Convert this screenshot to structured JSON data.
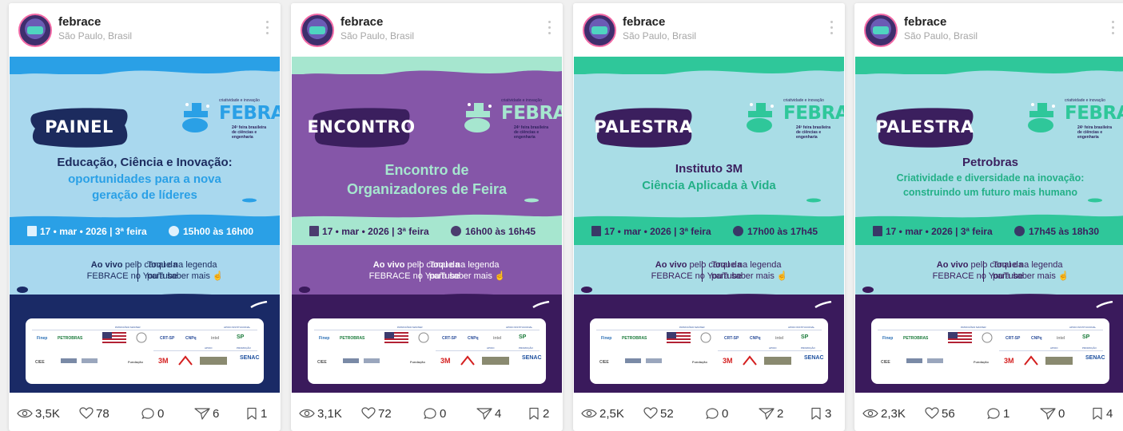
{
  "posts": [
    {
      "user": "febrace",
      "location": "São Paulo, Brasil",
      "tag": "PAINEL",
      "title_lines": [
        "Educação, Ciência e Inovação:"
      ],
      "subtitle_lines": [
        "oportunidades para a nova",
        "geração de líderes"
      ],
      "date": "17 • mar • 2026 | 3ª feira",
      "time": "15h00 às 16h00",
      "live_bold": "Ao vivo",
      "live_rest": " pelo canal da",
      "live_line2": "FEBRACE no YouTube",
      "hint_line1": "Toque na legenda",
      "hint_line2": "para saber mais ☝",
      "stats": {
        "views": "3,5K",
        "likes": "78",
        "comments": "0",
        "shares": "6",
        "saves": "1"
      },
      "colors": {
        "top": "#2aa0e6",
        "main": "#a9d8ee",
        "tag_bg": "#1c2b5e",
        "title": "#1c2b5e",
        "subtitle": "#2aa0e6",
        "date_band": "#2aa0e6",
        "date_text": "#ffffff",
        "bottom": "#1a2a66",
        "text": "#1c2b5e",
        "logo": "#2aa0e6"
      }
    },
    {
      "user": "febrace",
      "location": "São Paulo, Brasil",
      "tag": "ENCONTRO",
      "title_lines": [
        "Encontro de",
        "Organizadores de Feira"
      ],
      "subtitle_lines": [],
      "date": "17 • mar • 2026 | 3ª feira",
      "time": "16h00 às 16h45",
      "live_bold": "Ao vivo",
      "live_rest": " pelo canal da",
      "live_line2": "FEBRACE no YouTube",
      "hint_line1": "Toque na legenda",
      "hint_line2": "para saber mais ☝",
      "stats": {
        "views": "3,1K",
        "likes": "72",
        "comments": "0",
        "shares": "4",
        "saves": "2"
      },
      "colors": {
        "top": "#a6e6cf",
        "main": "#8556a8",
        "tag_bg": "#3b1f5e",
        "title": "#a6e6cf",
        "subtitle": "#a6e6cf",
        "date_band": "#a6e6cf",
        "date_text": "#3b1f5e",
        "bottom": "#3a1a5c",
        "text": "#ffffff",
        "logo": "#a6e6cf"
      }
    },
    {
      "user": "febrace",
      "location": "São Paulo, Brasil",
      "tag": "PALESTRA",
      "title_lines": [
        "Instituto 3M"
      ],
      "subtitle_lines": [
        "Ciência Aplicada à Vida"
      ],
      "date": "17 • mar • 2026 | 3ª feira",
      "time": "17h00 às 17h45",
      "live_bold": "Ao vivo",
      "live_rest": " pelo canal da",
      "live_line2": "FEBRACE no YouTube",
      "hint_line1": "Toque na legenda",
      "hint_line2": "para saber mais ☝",
      "stats": {
        "views": "2,5K",
        "likes": "52",
        "comments": "0",
        "shares": "2",
        "saves": "3"
      },
      "colors": {
        "top": "#2fc79a",
        "main": "#a9dde6",
        "tag_bg": "#3b1f5e",
        "title": "#3b1f5e",
        "subtitle": "#23b087",
        "date_band": "#2fc79a",
        "date_text": "#3b1f5e",
        "bottom": "#3a1a5c",
        "text": "#3b1f5e",
        "logo": "#2fc79a"
      }
    },
    {
      "user": "febrace",
      "location": "São Paulo, Brasil",
      "tag": "PALESTRA",
      "title_lines": [
        "Petrobras"
      ],
      "subtitle_lines": [
        "Criatividade e diversidade na inovação:",
        "construindo um futuro mais humano"
      ],
      "date": "17 • mar • 2026 | 3ª feira",
      "time": "17h45 às 18h30",
      "live_bold": "Ao vivo",
      "live_rest": " pelo canal da",
      "live_line2": "FEBRACE no YouTube",
      "hint_line1": "Toque na legenda",
      "hint_line2": "para saber mais ☝",
      "stats": {
        "views": "2,3K",
        "likes": "56",
        "comments": "1",
        "shares": "0",
        "saves": "4"
      },
      "colors": {
        "top": "#2fc79a",
        "main": "#a9dde6",
        "tag_bg": "#3b1f5e",
        "title": "#3b1f5e",
        "subtitle": "#23b087",
        "date_band": "#2fc79a",
        "date_text": "#3b1f5e",
        "bottom": "#3a1a5c",
        "text": "#3b1f5e",
        "logo": "#2fc79a"
      }
    }
  ],
  "logo": {
    "small_text": "criatividade e inovação",
    "name": "FEBRACE",
    "sub_text": "24ª feira brasileira de ciências e engenharia"
  },
  "sponsors": {
    "patrocinio": "PATROCÍNIO MASTER",
    "apoio_inst": "APOIO INSTITUCIONAL",
    "apoio": "APOIO",
    "promocao": "PROMOÇÃO",
    "finep": "Finep",
    "petrobras": "PETROBRAS",
    "cie": "CIEE",
    "crt": "CRT-SP",
    "cnpq": "CNPq",
    "intel": "intel",
    "fundacao": "Fundação",
    "m3": "3M",
    "senac": "SENAC"
  }
}
